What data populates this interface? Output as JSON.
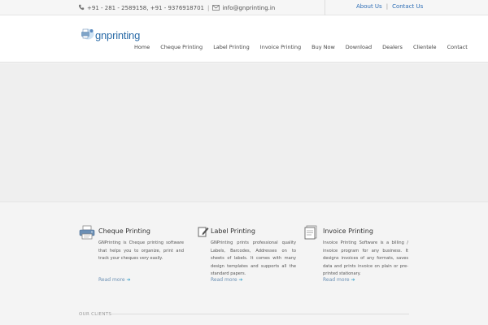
{
  "topbar": {
    "phone_text": "+91 - 281 - 2589158, +91 - 9376918701",
    "divider": "|",
    "email_text": "info@gnprinting.in",
    "about_link": "About Us",
    "link_divider": "|",
    "contact_link": "Contact Us"
  },
  "header": {
    "logo_text": "gnprinting",
    "nav": [
      "Home",
      "Cheque Printing",
      "Label Printing",
      "Invoice Printing",
      "Buy Now",
      "Download",
      "Dealers",
      "Clientele",
      "Contact"
    ]
  },
  "features": [
    {
      "title": "Cheque Printing",
      "description": "GNPrinting is Cheque printing software that helps you to organize, print and track your cheques very easily.",
      "more": "Read more",
      "icon": "printer-icon"
    },
    {
      "title": "Label Printing",
      "description": "GNPrinting prints professional quality Labels, Barcodes, Addresses on to sheets of labels. It comes with many design templates and supports all the standard papers.",
      "more": "Read more",
      "icon": "edit-pencil-icon"
    },
    {
      "title": "Invoice Printing",
      "description": "Invoice Printing Software is a billing / invoice program for any business. It designs invoices of any formats, saves data and prints invoice on plain or pre-printed stationary.",
      "more": "Read more",
      "icon": "document-icon"
    }
  ],
  "clients_heading": "OUR CLIENTS",
  "colors": {
    "link": "#2d6db5",
    "logo": "#2a6ba7",
    "read_more": "#6a8fb3",
    "arrow": "#3aa0c8"
  }
}
